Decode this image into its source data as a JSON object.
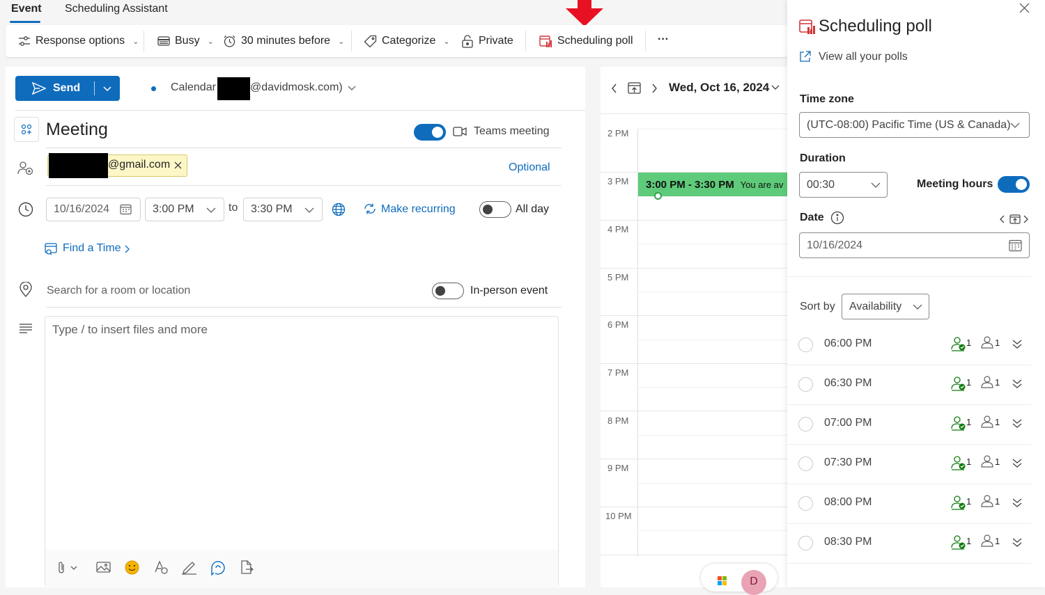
{
  "tabs": [
    {
      "label": "Event"
    },
    {
      "label": "Scheduling Assistant"
    }
  ],
  "toolbar": {
    "response_options": "Response options",
    "busy": "Busy",
    "reminder": "30 minutes before",
    "categorize": "Categorize",
    "private": "Private",
    "scheduling_poll": "Scheduling poll",
    "more": "···"
  },
  "compose": {
    "send_label": "Send",
    "calendar_label": "Calendar",
    "calendar_account": "@davidmosk.com)",
    "title": "Meeting",
    "teams_meeting": "Teams meeting",
    "teams_meeting_on": true,
    "attendee_email": "@gmail.com",
    "optional": "Optional",
    "start_date": "10/16/2024",
    "start_time": "3:00 PM",
    "to_label": "to",
    "end_time": "3:30 PM",
    "make_recurring": "Make recurring",
    "all_day": "All day",
    "all_day_on": false,
    "find_a_time": "Find a Time",
    "location_placeholder": "Search for a room or location",
    "in_person_event": "In-person event",
    "in_person_on": false,
    "body_placeholder": "Type / to insert files and more"
  },
  "calendar_view": {
    "date": "Wed, Oct 16, 2024",
    "hours": [
      "2 PM",
      "3 PM",
      "4 PM",
      "5 PM",
      "6 PM",
      "7 PM",
      "8 PM",
      "9 PM",
      "10 PM"
    ],
    "event": {
      "time": "3:00 PM - 3:30 PM",
      "note": "You are av"
    },
    "avatar_initial": "D"
  },
  "poll_panel": {
    "title": "Scheduling poll",
    "view_all": "View all your polls",
    "time_zone_label": "Time zone",
    "time_zone_value": "(UTC-08:00) Pacific Time (US & Canada)",
    "duration_label": "Duration",
    "duration_value": "00:30",
    "meeting_hours_label": "Meeting hours",
    "meeting_hours_on": true,
    "date_label": "Date",
    "date_value": "10/16/2024",
    "sort_by_label": "Sort by",
    "sort_by_value": "Availability",
    "slots": [
      {
        "time": "06:00 PM",
        "available": "1",
        "attendees": "1"
      },
      {
        "time": "06:30 PM",
        "available": "1",
        "attendees": "1"
      },
      {
        "time": "07:00 PM",
        "available": "1",
        "attendees": "1"
      },
      {
        "time": "07:30 PM",
        "available": "1",
        "attendees": "1"
      },
      {
        "time": "08:00 PM",
        "available": "1",
        "attendees": "1"
      },
      {
        "time": "08:30 PM",
        "available": "1",
        "attendees": "1"
      }
    ]
  },
  "colors": {
    "accent": "#0f6cbd",
    "event_green": "#5dcb7a",
    "available_green": "#107c10",
    "annotation_red": "#e81123",
    "poll_icon": "#d13438"
  }
}
